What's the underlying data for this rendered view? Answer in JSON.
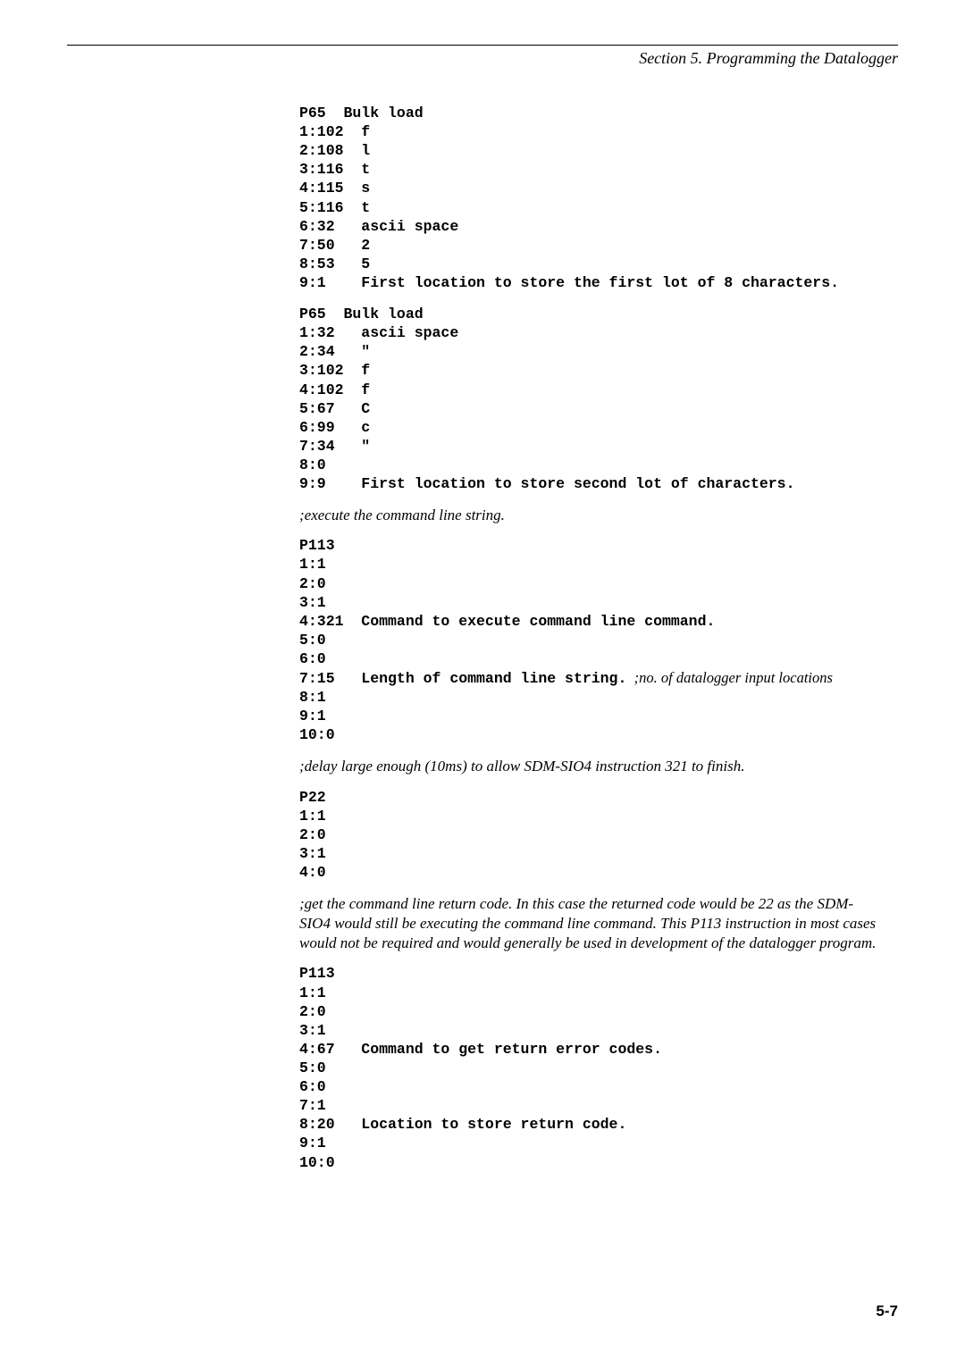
{
  "header": {
    "section_title": "Section 5.  Programming the Datalogger"
  },
  "block1": {
    "l1": "P65  Bulk load",
    "l2": "1:102  f",
    "l3": "2:108  l",
    "l4": "3:116  t",
    "l5": "4:115  s",
    "l6": "5:116  t",
    "l7": "6:32   ascii space",
    "l8": "7:50   2",
    "l9": "8:53   5",
    "l10": "9:1    First location to store the first lot of 8 characters."
  },
  "block2": {
    "l1": "P65  Bulk load",
    "l2": "1:32   ascii space",
    "l3": "2:34   \"",
    "l4": "3:102  f",
    "l5": "4:102  f",
    "l6": "5:67   C",
    "l7": "6:99   c",
    "l8": "7:34   \"",
    "l9": "8:0",
    "l10": "9:9    First location to store second lot of characters."
  },
  "comment1": ";execute the command line string.",
  "block3": {
    "l1": "P113",
    "l2": "1:1",
    "l3": "2:0",
    "l4": "3:1",
    "l5": "4:321  Command to execute command line command.",
    "l6": "5:0",
    "l7": "6:0",
    "l8a": "7:15   Length of command line string.",
    "l8b": "  ;no. of datalogger input locations",
    "l9": "8:1",
    "l10": "9:1",
    "l11": "10:0"
  },
  "comment2": ";delay large enough (10ms) to allow SDM-SIO4 instruction 321 to finish.",
  "block4": {
    "l1": "P22",
    "l2": "1:1",
    "l3": "2:0",
    "l4": "3:1",
    "l5": "4:0"
  },
  "comment3": ";get the command line return code. In this case the returned code would be 22 as the SDM-SIO4 would still be executing the command line command. This P113 instruction in most cases would not be required and would generally be used in development of the datalogger program.",
  "block5": {
    "l1": "P113",
    "l2": "1:1",
    "l3": "2:0",
    "l4": "3:1",
    "l5": "4:67   Command to get return error codes.",
    "l6": "5:0",
    "l7": "6:0",
    "l8": "7:1",
    "l9": "8:20   Location to store return code.",
    "l10": "9:1",
    "l11": "10:0"
  },
  "footer": {
    "page_number": "5-7"
  }
}
